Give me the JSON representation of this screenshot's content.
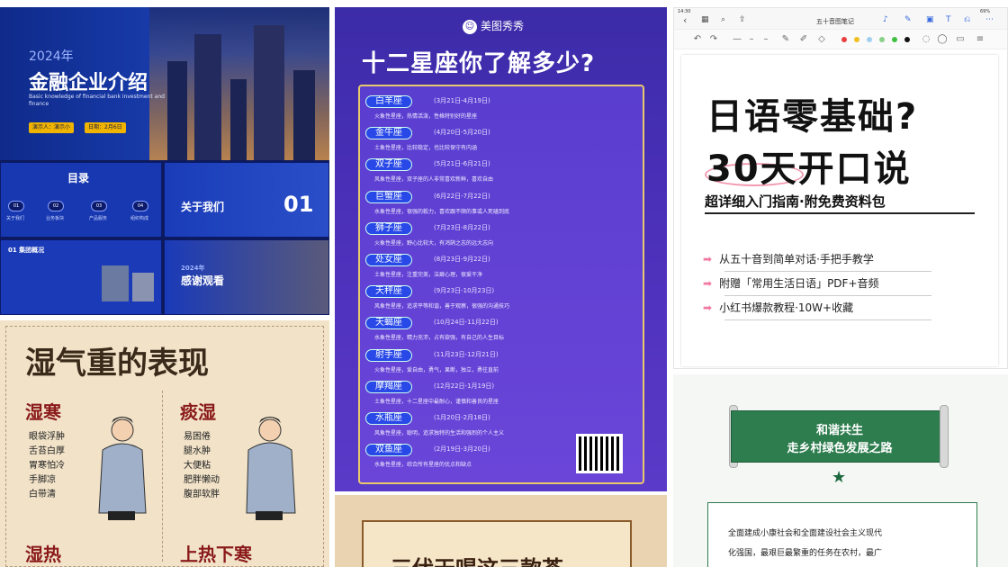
{
  "finance": {
    "year": "2024年",
    "title": "金融企业介绍",
    "subtitle_en": "Basic knowledge of financial bank investment and finance",
    "presenter": "演示人：演示小",
    "date": "日期：2月6日",
    "toc_title": "目录",
    "toc_items": [
      {
        "num": "01",
        "label": "关于我们"
      },
      {
        "num": "02",
        "label": "业务板块"
      },
      {
        "num": "03",
        "label": "产品服务"
      },
      {
        "num": "04",
        "label": "组织构成"
      }
    ],
    "about_title": "关于我们",
    "about_num": "01",
    "profile_title": "01 集团概况",
    "thanks_year": "2024年",
    "thanks": "感谢观看"
  },
  "zodiac": {
    "brand": "美图秀秀",
    "title": "十二星座你了解多少?",
    "signs": [
      {
        "name": "白羊座",
        "date": "(3月21日-4月19日)",
        "desc": "火象性星座，热情活泼，性格特别好的星座"
      },
      {
        "name": "金牛座",
        "date": "(4月20日-5月20日)",
        "desc": "土象性星座，比较稳定，也比较保守有内涵"
      },
      {
        "name": "双子座",
        "date": "(5月21日-6月21日)",
        "desc": "风象性星座，双子座的人非常喜欢新鲜，喜欢自由"
      },
      {
        "name": "巨蟹座",
        "date": "(6月22日-7月22日)",
        "desc": "水象性星座，很强的毅力，喜欢跟不顺的事或人死磕到底"
      },
      {
        "name": "狮子座",
        "date": "(7月23日-8月22日)",
        "desc": "火象性星座，野心比较大，有鸿鹄之志的远大志向"
      },
      {
        "name": "处女座",
        "date": "(8月23日-9月22日)",
        "desc": "土象性星座，注重完美，洁癖心理，很爱干净"
      },
      {
        "name": "天秤座",
        "date": "(9月23日-10月23日)",
        "desc": "风象性星座，追求平等和谐，善于观察，很强的沟通技巧"
      },
      {
        "name": "天蝎座",
        "date": "(10月24日-11月22日)",
        "desc": "水象性星座，精力充沛，占有欲强，有自己的人生目标"
      },
      {
        "name": "射手座",
        "date": "(11月23日-12月21日)",
        "desc": "火象性星座，爱自由，勇气，果断，独立，勇往直前"
      },
      {
        "name": "摩羯座",
        "date": "(12月22日-1月19日)",
        "desc": "土象性星座，十二星座中最耐心，谨慎和善良的星座"
      },
      {
        "name": "水瓶座",
        "date": "(1月20日-2月18日)",
        "desc": "风象性星座，聪明，追求独特的生活和强烈的个人主义"
      },
      {
        "name": "双鱼座",
        "date": "(2月19日-3月20日)",
        "desc": "水象性星座，综合所有星座的优点和缺点"
      }
    ]
  },
  "editor": {
    "status_time": "14:30",
    "doc_title": "五十音图笔记",
    "battery": "69%",
    "headline_1": "日语零基础?",
    "headline_2": "30天开口说",
    "subtitle": "超详细入门指南·附免费资料包",
    "bullets": [
      "从五十音到简单对话·手把手教学",
      "附赠「常用生活日语」PDF+音频",
      "小红书爆款教程·10W+收藏"
    ]
  },
  "herbal": {
    "title": "湿气重的表现",
    "sec1": "湿寒",
    "sec1_items": [
      "眼袋浮肿",
      "舌苔白厚",
      "胃寒怕冷",
      "手脚凉",
      "白带清"
    ],
    "sec2": "痰湿",
    "sec2_items": [
      "易困倦",
      "腿水肿",
      "大便粘",
      "肥胖懒动",
      "腹部软胖"
    ],
    "sec3": "湿热",
    "sec4": "上热下寒"
  },
  "tea": {
    "title": "三伏天喝这三款茶"
  },
  "green": {
    "line1": "和谐共生",
    "line2": "走乡村绿色发展之路",
    "body1": "全面建成小康社会和全面建设社会主义现代",
    "body2": "化强国，最艰巨最繁重的任务在农村，最广"
  }
}
